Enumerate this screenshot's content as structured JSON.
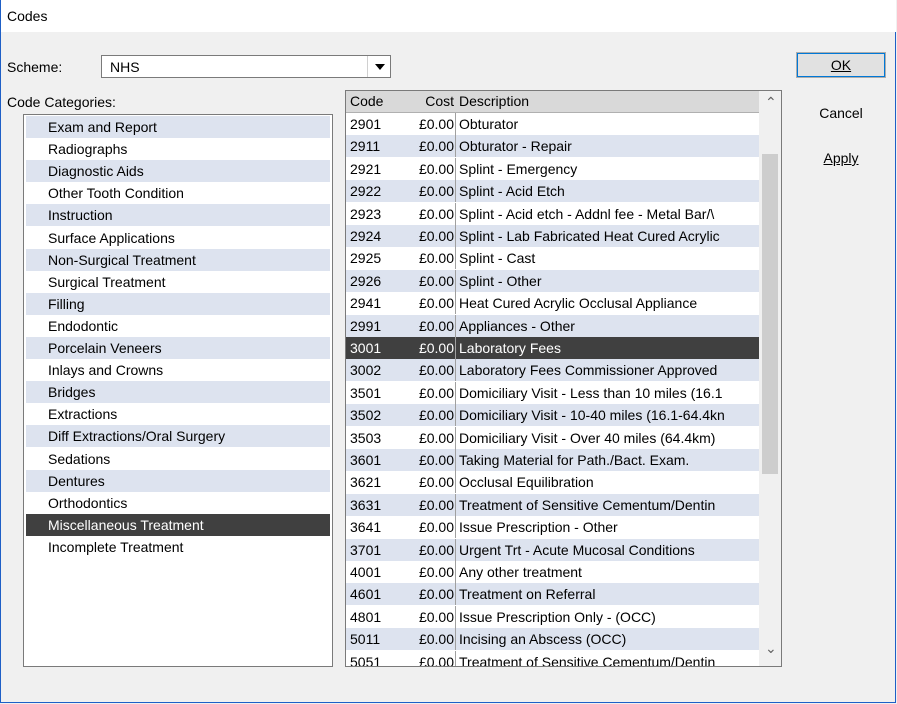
{
  "window": {
    "title": "Codes"
  },
  "scheme": {
    "label": "Scheme:",
    "value": "NHS"
  },
  "categories": {
    "label": "Code Categories:",
    "items": [
      "Exam and Report",
      "Radiographs",
      "Diagnostic Aids",
      "Other Tooth Condition",
      "Instruction",
      "Surface Applications",
      "Non-Surgical Treatment",
      "Surgical Treatment",
      "Filling",
      "Endodontic",
      "Porcelain Veneers",
      "Inlays and Crowns",
      "Bridges",
      "Extractions",
      "Diff Extractions/Oral Surgery",
      "Sedations",
      "Dentures",
      "Orthodontics",
      "Miscellaneous Treatment",
      "Incomplete Treatment"
    ],
    "selected_index": 18
  },
  "grid": {
    "columns": {
      "code": "Code",
      "cost": "Cost",
      "description": "Description"
    },
    "selected_index": 10,
    "rows": [
      {
        "code": "2901",
        "cost": "£0.00",
        "description": "Obturator"
      },
      {
        "code": "2911",
        "cost": "£0.00",
        "description": "Obturator - Repair"
      },
      {
        "code": "2921",
        "cost": "£0.00",
        "description": "Splint - Emergency"
      },
      {
        "code": "2922",
        "cost": "£0.00",
        "description": "Splint - Acid Etch"
      },
      {
        "code": "2923",
        "cost": "£0.00",
        "description": "Splint - Acid etch - Addnl fee - Metal Bar/\\"
      },
      {
        "code": "2924",
        "cost": "£0.00",
        "description": "Splint - Lab Fabricated Heat Cured Acrylic"
      },
      {
        "code": "2925",
        "cost": "£0.00",
        "description": "Splint - Cast"
      },
      {
        "code": "2926",
        "cost": "£0.00",
        "description": "Splint - Other"
      },
      {
        "code": "2941",
        "cost": "£0.00",
        "description": "Heat Cured Acrylic Occlusal Appliance"
      },
      {
        "code": "2991",
        "cost": "£0.00",
        "description": "Appliances - Other"
      },
      {
        "code": "3001",
        "cost": "£0.00",
        "description": "Laboratory Fees"
      },
      {
        "code": "3002",
        "cost": "£0.00",
        "description": "Laboratory Fees Commissioner Approved"
      },
      {
        "code": "3501",
        "cost": "£0.00",
        "description": "Domiciliary Visit - Less than 10 miles (16.1"
      },
      {
        "code": "3502",
        "cost": "£0.00",
        "description": "Domiciliary Visit - 10-40 miles (16.1-64.4kn"
      },
      {
        "code": "3503",
        "cost": "£0.00",
        "description": "Domiciliary Visit - Over 40 miles (64.4km)"
      },
      {
        "code": "3601",
        "cost": "£0.00",
        "description": "Taking Material for Path./Bact. Exam."
      },
      {
        "code": "3621",
        "cost": "£0.00",
        "description": "Occlusal Equilibration"
      },
      {
        "code": "3631",
        "cost": "£0.00",
        "description": "Treatment of Sensitive Cementum/Dentin"
      },
      {
        "code": "3641",
        "cost": "£0.00",
        "description": "Issue Prescription - Other"
      },
      {
        "code": "3701",
        "cost": "£0.00",
        "description": "Urgent Trt - Acute Mucosal Conditions"
      },
      {
        "code": "4001",
        "cost": "£0.00",
        "description": "Any other  treatment"
      },
      {
        "code": "4601",
        "cost": "£0.00",
        "description": "Treatment on Referral"
      },
      {
        "code": "4801",
        "cost": "£0.00",
        "description": "Issue Prescription Only - (OCC)"
      },
      {
        "code": "5011",
        "cost": "£0.00",
        "description": "Incising an Abscess (OCC)"
      },
      {
        "code": "5051",
        "cost": "£0.00",
        "description": "Treatment of Sensitive Cementum/Dentin"
      }
    ]
  },
  "buttons": {
    "ok": "OK",
    "cancel": "Cancel",
    "apply": "Apply"
  },
  "colors": {
    "selection": "#404040",
    "alt_row": "#dde3ef",
    "focus": "#0078d7"
  }
}
